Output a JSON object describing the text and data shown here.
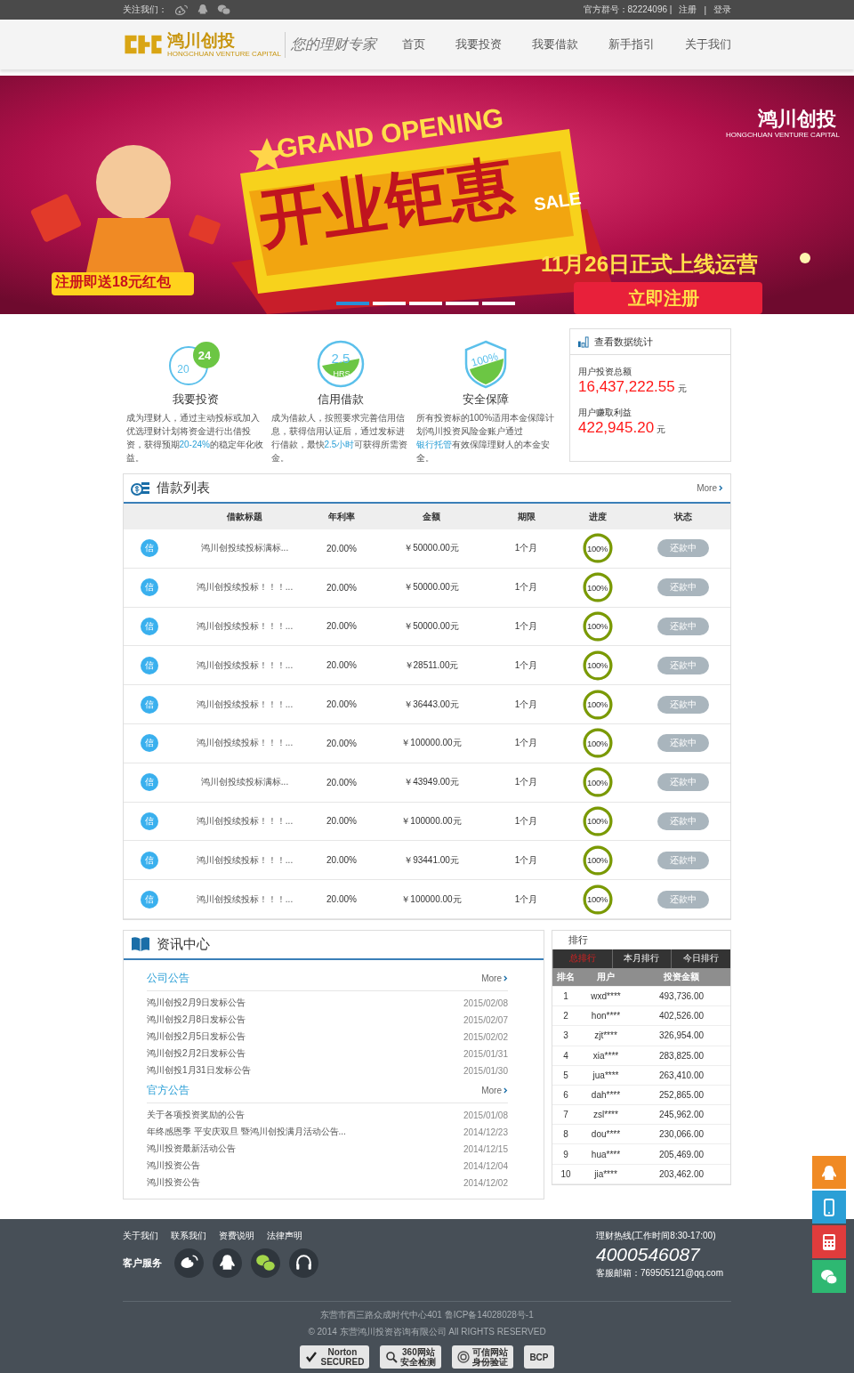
{
  "top_bar": {
    "follow_label": "关注我们：",
    "group": "官方群号：82224096 |",
    "links": [
      "注册",
      "登录"
    ],
    "separator": "|"
  },
  "header": {
    "logo": {
      "name": "鸿川创投",
      "english": "HONGCHUAN VENTURE CAPITAL",
      "slogan": "您的理财专家"
    },
    "nav": [
      {
        "label": "首页",
        "selected": false
      },
      {
        "label": "我要投资",
        "selected": false
      },
      {
        "label": "我要借款",
        "selected": false
      },
      {
        "label": "新手指引",
        "selected": false
      },
      {
        "label": "关于我们",
        "selected": false
      }
    ]
  },
  "banner": {
    "kind": "picture",
    "headline": "GRAND OPENING",
    "title": "开业钜惠",
    "sale": "SALE",
    "date": "11月26日正式上线运营",
    "gift": "注册即送18元红包",
    "cta": "立即注册",
    "logo_name": "鸿川创投",
    "logo_english": "HONGCHUAN VENTURE CAPITAL",
    "dots": [
      {
        "selected": true
      },
      {
        "selected": false
      },
      {
        "selected": false
      },
      {
        "selected": false
      },
      {
        "selected": false
      }
    ]
  },
  "features": [
    {
      "kind": "invest",
      "icon_big": "24",
      "icon_small": "20",
      "title": "我要投资",
      "description": [
        {
          "text": "成为理财人，通过主动投标或加入优选理财计划将资金进行出借投资，获得预期"
        },
        {
          "text": "20-24%",
          "link": true
        },
        {
          "text": "的稳定年化收益。"
        }
      ]
    },
    {
      "kind": "loan",
      "icon_big": "2.5",
      "icon_small": "HRS",
      "title": "信用借款",
      "description": [
        {
          "text": "成为借款人，按照要求完善信用信息，获得信用认证后，通过发标进行借款，最快"
        },
        {
          "text": "2.5小时",
          "link": true
        },
        {
          "text": "可获得所需资金。"
        }
      ]
    },
    {
      "kind": "safety",
      "icon_big": "100",
      "icon_small": "%",
      "title": "安全保障",
      "description": [
        {
          "text": "所有投资标的100%适用本金保障计划鸿川投资风险金账户通过"
        },
        {
          "text": "银行托管",
          "link": true
        },
        {
          "text": "有效保障理财人的本金安全。"
        }
      ]
    }
  ],
  "stats": {
    "title": "查看数据统计",
    "items": [
      {
        "label": "用户投资总额",
        "value": "16,437,222.55",
        "unit": "元"
      },
      {
        "label": "用户赚取利益",
        "value": "422,945.20",
        "unit": "元"
      }
    ]
  },
  "loan_list": {
    "title": "借款列表",
    "more": "More",
    "columns": [
      "借款标题",
      "年利率",
      "金额",
      "期限",
      "进度",
      "状态"
    ],
    "rows": [
      {
        "badge": "信",
        "title": "鸿川创投续投标满标...",
        "rate": "20.00%",
        "amount": "￥50000.00元",
        "term": "1个月",
        "progress": "100%",
        "level": 1,
        "status": "还款中"
      },
      {
        "badge": "信",
        "title": "鸿川创投续投标！！！...",
        "rate": "20.00%",
        "amount": "￥50000.00元",
        "term": "1个月",
        "progress": "100%",
        "level": 1,
        "status": "还款中"
      },
      {
        "badge": "信",
        "title": "鸿川创投续投标！！！...",
        "rate": "20.00%",
        "amount": "￥50000.00元",
        "term": "1个月",
        "progress": "100%",
        "level": 1,
        "status": "还款中"
      },
      {
        "badge": "信",
        "title": "鸿川创投续投标！！！...",
        "rate": "20.00%",
        "amount": "￥28511.00元",
        "term": "1个月",
        "progress": "100%",
        "level": 1,
        "status": "还款中"
      },
      {
        "badge": "信",
        "title": "鸿川创投续投标！！！...",
        "rate": "20.00%",
        "amount": "￥36443.00元",
        "term": "1个月",
        "progress": "100%",
        "level": 1,
        "status": "还款中"
      },
      {
        "badge": "信",
        "title": "鸿川创投续投标！！！...",
        "rate": "20.00%",
        "amount": "￥100000.00元",
        "term": "1个月",
        "progress": "100%",
        "level": 1,
        "status": "还款中"
      },
      {
        "badge": "信",
        "title": "鸿川创投续投标满标...",
        "rate": "20.00%",
        "amount": "￥43949.00元",
        "term": "1个月",
        "progress": "100%",
        "level": 1,
        "status": "还款中"
      },
      {
        "badge": "信",
        "title": "鸿川创投续投标！！！...",
        "rate": "20.00%",
        "amount": "￥100000.00元",
        "term": "1个月",
        "progress": "100%",
        "level": 1,
        "status": "还款中"
      },
      {
        "badge": "信",
        "title": "鸿川创投续投标！！！...",
        "rate": "20.00%",
        "amount": "￥93441.00元",
        "term": "1个月",
        "progress": "100%",
        "level": 1,
        "status": "还款中"
      },
      {
        "badge": "信",
        "title": "鸿川创投续投标！！！...",
        "rate": "20.00%",
        "amount": "￥100000.00元",
        "term": "1个月",
        "progress": "100%",
        "level": 1,
        "status": "还款中"
      }
    ]
  },
  "news": {
    "title": "资讯中心",
    "sections": [
      {
        "title": "公司公告",
        "more": "More",
        "items": [
          {
            "title": "鸿川创投2月9日发标公告",
            "date": "2015/02/08"
          },
          {
            "title": "鸿川创投2月8日发标公告",
            "date": "2015/02/07"
          },
          {
            "title": "鸿川创投2月5日发标公告",
            "date": "2015/02/02"
          },
          {
            "title": "鸿川创投2月2日发标公告",
            "date": "2015/01/31"
          },
          {
            "title": "鸿川创投1月31日发标公告",
            "date": "2015/01/30"
          }
        ]
      },
      {
        "title": "官方公告",
        "more": "More",
        "items": [
          {
            "title": "关于各项投资奖励的公告",
            "date": "2015/01/08"
          },
          {
            "title": "年终感恩季 平安庆双旦 暨鸿川创投满月活动公告...",
            "date": "2014/12/23"
          },
          {
            "title": "鸿川投资最新活动公告",
            "date": "2014/12/15"
          },
          {
            "title": "鸿川投资公告",
            "date": "2014/12/04"
          },
          {
            "title": "鸿川投资公告",
            "date": "2014/12/02"
          }
        ]
      }
    ]
  },
  "ranking": {
    "title": "排行",
    "tabs": [
      {
        "label": "总排行",
        "selected": true
      },
      {
        "label": "本月排行",
        "selected": false
      },
      {
        "label": "今日排行",
        "selected": false
      }
    ],
    "columns": [
      "排名",
      "用户",
      "投资金额"
    ],
    "rows": [
      {
        "rank": "1",
        "user": "wxd****",
        "amount": "493,736.00"
      },
      {
        "rank": "2",
        "user": "hon****",
        "amount": "402,526.00"
      },
      {
        "rank": "3",
        "user": "zjt****",
        "amount": "326,954.00"
      },
      {
        "rank": "4",
        "user": "xia****",
        "amount": "283,825.00"
      },
      {
        "rank": "5",
        "user": "jua****",
        "amount": "263,410.00"
      },
      {
        "rank": "6",
        "user": "dah****",
        "amount": "252,865.00"
      },
      {
        "rank": "7",
        "user": "zsl****",
        "amount": "245,962.00"
      },
      {
        "rank": "8",
        "user": "dou****",
        "amount": "230,066.00"
      },
      {
        "rank": "9",
        "user": "hua****",
        "amount": "205,469.00"
      },
      {
        "rank": "10",
        "user": "jia****",
        "amount": "203,462.00"
      }
    ]
  },
  "footer": {
    "links": [
      "关于我们",
      "联系我们",
      "资费说明",
      "法律声明"
    ],
    "service_label": "客户服务",
    "hotline_label": "理财热线(工作时间8:30-17:00)",
    "hotline": "4000546087",
    "email": "客服邮箱：769505121@qq.com",
    "address": "东营市西三路众成时代中心401 鲁ICP备14028028号-1",
    "copyright": "© 2014 东营鸿川投资咨询有限公司 All RIGHTS RESERVED",
    "badges": [
      {
        "kind": "norton",
        "lines": [
          "Norton",
          "SECURED"
        ]
      },
      {
        "kind": "scan",
        "lines": [
          "360网站",
          "安全检测"
        ]
      },
      {
        "kind": "trusted",
        "lines": [
          "可信网站",
          "身份验证"
        ]
      },
      {
        "kind": "bcp",
        "lines": [
          "BCP"
        ]
      }
    ]
  },
  "side_buttons": [
    {
      "kind": "qq",
      "color": "#f08a24"
    },
    {
      "kind": "phone",
      "color": "#2a9fd6"
    },
    {
      "kind": "calculator",
      "color": "#e03c3c"
    },
    {
      "kind": "wechat",
      "color": "#2eb872"
    }
  ]
}
